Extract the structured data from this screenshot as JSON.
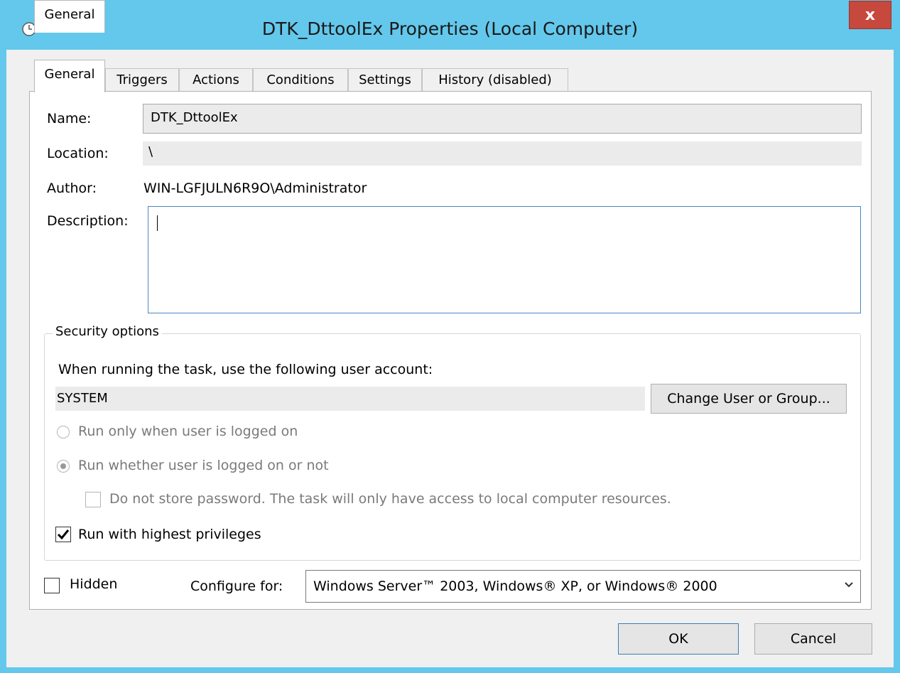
{
  "window": {
    "title": "DTK_DttoolEx Properties (Local Computer)",
    "close_label": "x"
  },
  "tabs": [
    {
      "label": "General"
    },
    {
      "label": "Triggers"
    },
    {
      "label": "Actions"
    },
    {
      "label": "Conditions"
    },
    {
      "label": "Settings"
    },
    {
      "label": "History (disabled)"
    }
  ],
  "general": {
    "name_label": "Name:",
    "name_value": "DTK_DttoolEx",
    "location_label": "Location:",
    "location_value": "\\",
    "author_label": "Author:",
    "author_value": "WIN-LGFJULN6R9O\\Administrator",
    "description_label": "Description:",
    "description_value": ""
  },
  "security": {
    "title": "Security options",
    "account_prompt": "When running the task, use the following user account:",
    "account_value": "SYSTEM",
    "change_button": "Change User or Group...",
    "radio_logged_on": "Run only when user is logged on",
    "radio_whether": "Run whether user is logged on or not",
    "no_password": "Do not store password.  The task will only have access to local computer resources.",
    "highest_privileges": "Run with highest privileges"
  },
  "bottom": {
    "hidden_label": "Hidden",
    "configure_label": "Configure for:",
    "configure_value": "Windows Server™ 2003, Windows® XP, or Windows® 2000"
  },
  "buttons": {
    "ok": "OK",
    "cancel": "Cancel"
  }
}
